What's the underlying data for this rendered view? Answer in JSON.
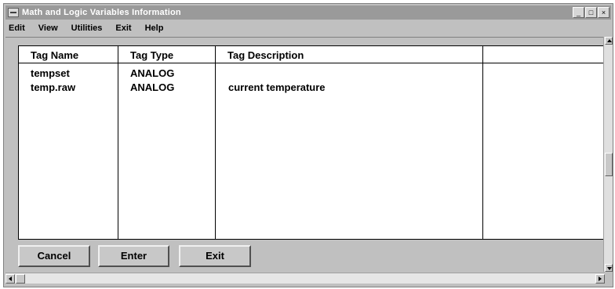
{
  "window": {
    "title": "Math and Logic Variables Information",
    "controls": {
      "minimize": "_",
      "maximize": "□",
      "close": "×"
    }
  },
  "menu": [
    "Edit",
    "View",
    "Utilities",
    "Exit",
    "Help"
  ],
  "table": {
    "columns": [
      "Tag Name",
      "Tag Type",
      "Tag Description",
      ""
    ],
    "rows": [
      {
        "name": "tempset",
        "type": "ANALOG",
        "description": ""
      },
      {
        "name": "temp.raw",
        "type": "ANALOG",
        "description": "current temperature"
      }
    ]
  },
  "buttons": {
    "cancel": "Cancel",
    "enter": "Enter",
    "exit": "Exit"
  },
  "colors": {
    "title_bar": "#9a9a9a",
    "window_face": "#c0c0c0",
    "table_bg": "#ffffff"
  }
}
